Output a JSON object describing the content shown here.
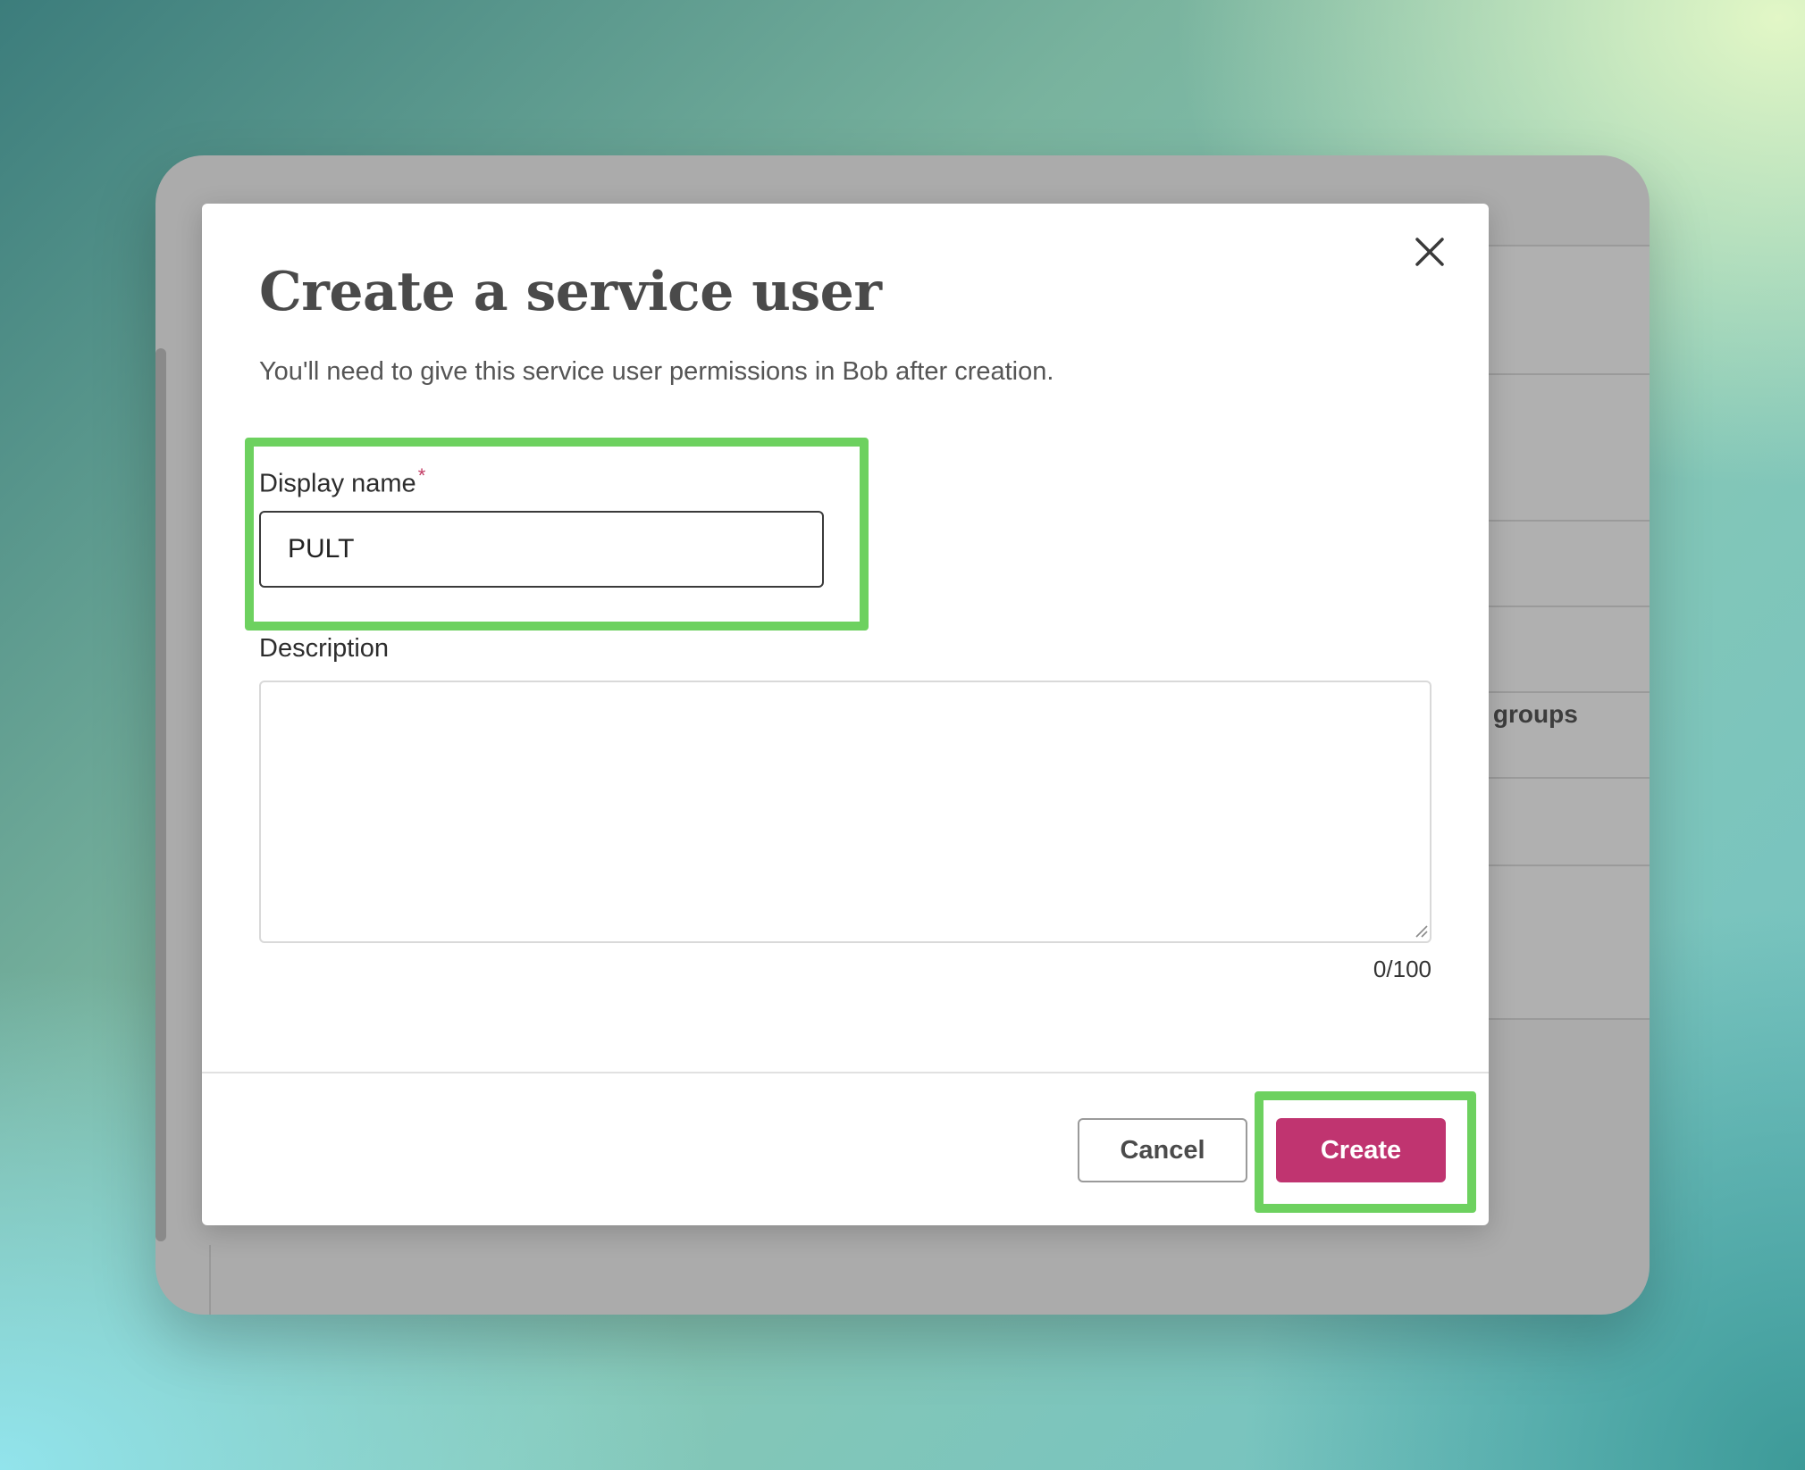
{
  "background_app": {
    "column_header": "n groups"
  },
  "dialog": {
    "title": "Create a service user",
    "subtitle": "You'll need to give this service user permissions in Bob after creation.",
    "close_icon": "close-icon",
    "display_name": {
      "label": "Display name",
      "required_marker": "*",
      "value": "PULT"
    },
    "description": {
      "label": "Description",
      "value": "",
      "counter": "0/100"
    },
    "footer": {
      "cancel_label": "Cancel",
      "create_label": "Create"
    }
  },
  "colors": {
    "primary_button": "#c03470",
    "required_marker": "#c23a63",
    "highlight": "#6dd15f"
  }
}
